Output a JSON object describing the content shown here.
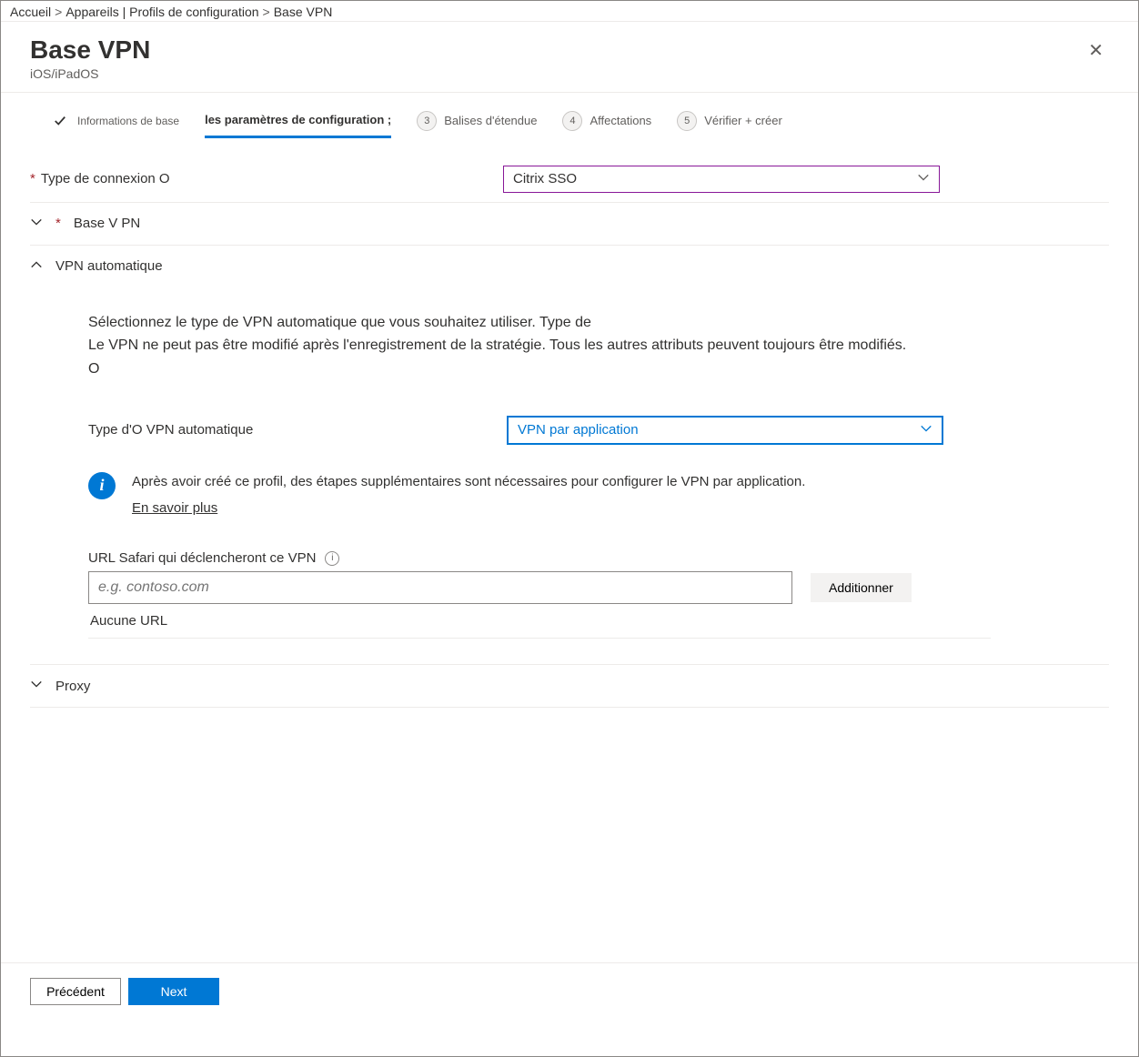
{
  "breadcrumb": {
    "b1": "Accueil",
    "b2": "Appareils | Profils de configuration",
    "b3": "Base VPN",
    "sep": ">"
  },
  "header": {
    "title": "Base VPN",
    "subtitle": "iOS/iPadOS"
  },
  "steps": {
    "s1": "Informations de base",
    "s2": "les paramètres de configuration ;",
    "s3": "Balises d'étendue",
    "s4": "Affectations",
    "s5": "Vérifier + créer",
    "n3": "3",
    "n4": "4",
    "n5": "5"
  },
  "conn": {
    "label": "Type de connexion O",
    "value": "Citrix SSO"
  },
  "sections": {
    "basevpn": "Base V PN",
    "autovpn": "VPN automatique",
    "proxy": "Proxy"
  },
  "autovpn": {
    "desc1": "Sélectionnez le type de VPN automatique que vous souhaitez utiliser. Type de",
    "desc2": "Le VPN ne peut pas être modifié après l'enregistrement de la stratégie. Tous les autres attributs peuvent toujours être modifiés. O",
    "typelabel": "Type d'O VPN automatique",
    "typevalue": "VPN par application",
    "infotext": "Après avoir créé ce profil, des étapes supplémentaires sont nécessaires pour configurer le VPN par application.",
    "learnmore": "En savoir plus",
    "urllabel": "URL Safari qui déclencheront ce VPN",
    "urlplaceholder": "e.g. contoso.com",
    "addbtn": "Additionner",
    "nourls": "Aucune URL"
  },
  "footer": {
    "prev": "Précédent",
    "next": "Next"
  }
}
